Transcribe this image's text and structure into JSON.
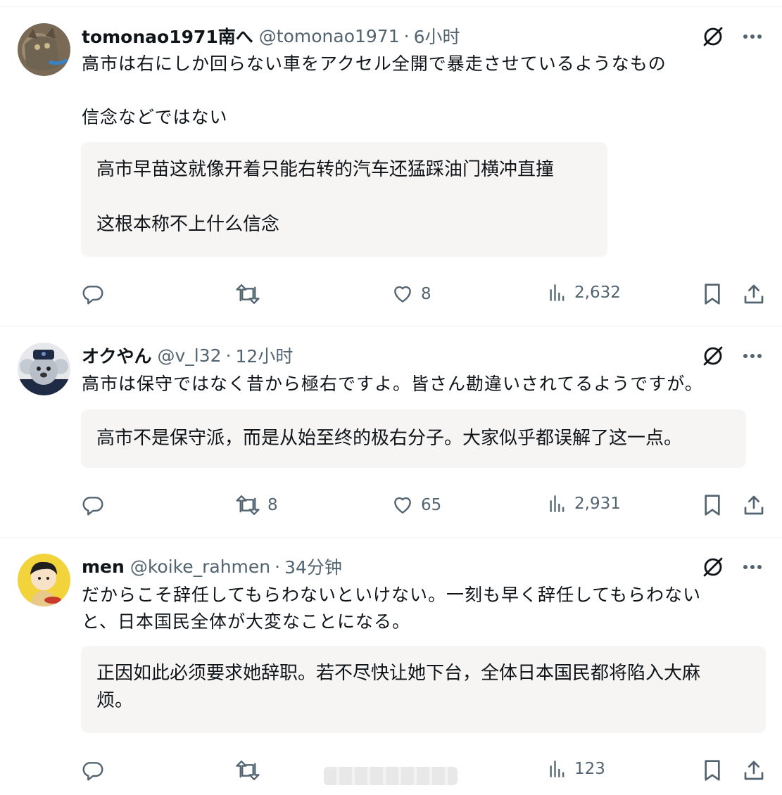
{
  "tweets": [
    {
      "name": "tomonao1971南へ",
      "handle": "@tomonao1971",
      "time": "6小时",
      "text": "高市は右にしか回らない車をアクセル全開で暴走させているようなもの\n\n信念などではない",
      "translation": "高市早苗这就像开着只能右转的汽车还猛踩油门横冲直撞\n\n这根本称不上什么信念",
      "replies": "",
      "retweets": "",
      "likes": "8",
      "views": "2,632"
    },
    {
      "name": "オクやん",
      "handle": "@v_l32",
      "time": "12小时",
      "text": "高市は保守ではなく昔から極右ですよ。皆さん勘違いされてるようですが。",
      "translation": "高市不是保守派，而是从始至终的极右分子。大家似乎都误解了这一点。",
      "replies": "",
      "retweets": "8",
      "likes": "65",
      "views": "2,931"
    },
    {
      "name": "men",
      "handle": "@koike_rahmen",
      "time": "34分钟",
      "text": "だからこそ辞任してもらわないといけない。一刻も早く辞任してもらわない\nと、日本国民全体が大変なことになる。",
      "translation": "正因如此必须要求她辞职。若不尽快让她下台，全体日本国民都将陷入大麻\n烦。",
      "replies": "",
      "retweets": "",
      "likes": "",
      "views": "123"
    }
  ],
  "colors": {
    "text": "#0f1419",
    "secondary": "#536471",
    "translation_bg": "#f7f5f4",
    "divider": "#eff3f4"
  }
}
